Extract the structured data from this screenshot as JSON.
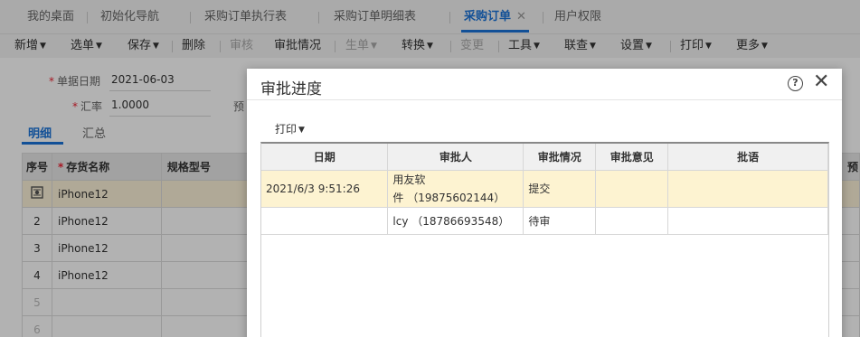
{
  "tabs": [
    {
      "label": "我的桌面",
      "active": false
    },
    {
      "label": "初始化导航",
      "active": false
    },
    {
      "label": "采购订单执行表",
      "active": false
    },
    {
      "label": "采购订单明细表",
      "active": false
    },
    {
      "label": "采购订单",
      "active": true
    },
    {
      "label": "用户权限",
      "active": false
    }
  ],
  "toolbar": {
    "new": "新增",
    "select": "选单",
    "save": "保存",
    "delete": "删除",
    "audit": "审核",
    "approval_status": "审批情况",
    "generate": "生单",
    "convert": "转换",
    "change": "变更",
    "tools": "工具",
    "link": "联查",
    "settings": "设置",
    "print": "打印",
    "more": "更多"
  },
  "form": {
    "date_label": "单据日期",
    "date_value": "2021-06-03",
    "rate_label": "汇率",
    "rate_value": "1.0000",
    "hidden_label_fragment": "预"
  },
  "subtabs": {
    "detail": "明细",
    "summary": "汇总"
  },
  "grid": {
    "headers": {
      "seq": "序号",
      "item": "存货名称",
      "spec": "规格型号",
      "tail": "预"
    },
    "rows": [
      {
        "seq": "",
        "item": "iPhone12"
      },
      {
        "seq": "2",
        "item": "iPhone12"
      },
      {
        "seq": "3",
        "item": "iPhone12"
      },
      {
        "seq": "4",
        "item": "iPhone12"
      },
      {
        "seq": "5",
        "item": ""
      },
      {
        "seq": "6",
        "item": ""
      }
    ]
  },
  "modal": {
    "title": "审批进度",
    "help_glyph": "?",
    "close_glyph": "✕",
    "print_label": "打印",
    "headers": {
      "date": "日期",
      "approver": "审批人",
      "status": "审批情况",
      "opinion": "审批意见",
      "comment": "批语"
    },
    "rows": [
      {
        "date": "2021/6/3 9:51:26",
        "approver_line1": "用友软",
        "approver_line2": "件 （19875602144）",
        "status": "提交",
        "opinion": "",
        "comment": ""
      },
      {
        "date": "",
        "approver_line1": "lcy （18786693548）",
        "approver_line2": "",
        "status": "待审",
        "opinion": "",
        "comment": ""
      }
    ]
  },
  "colors": {
    "accent": "#1a73d9",
    "selected_row": "#fdf3d1",
    "required": "#e23333"
  }
}
